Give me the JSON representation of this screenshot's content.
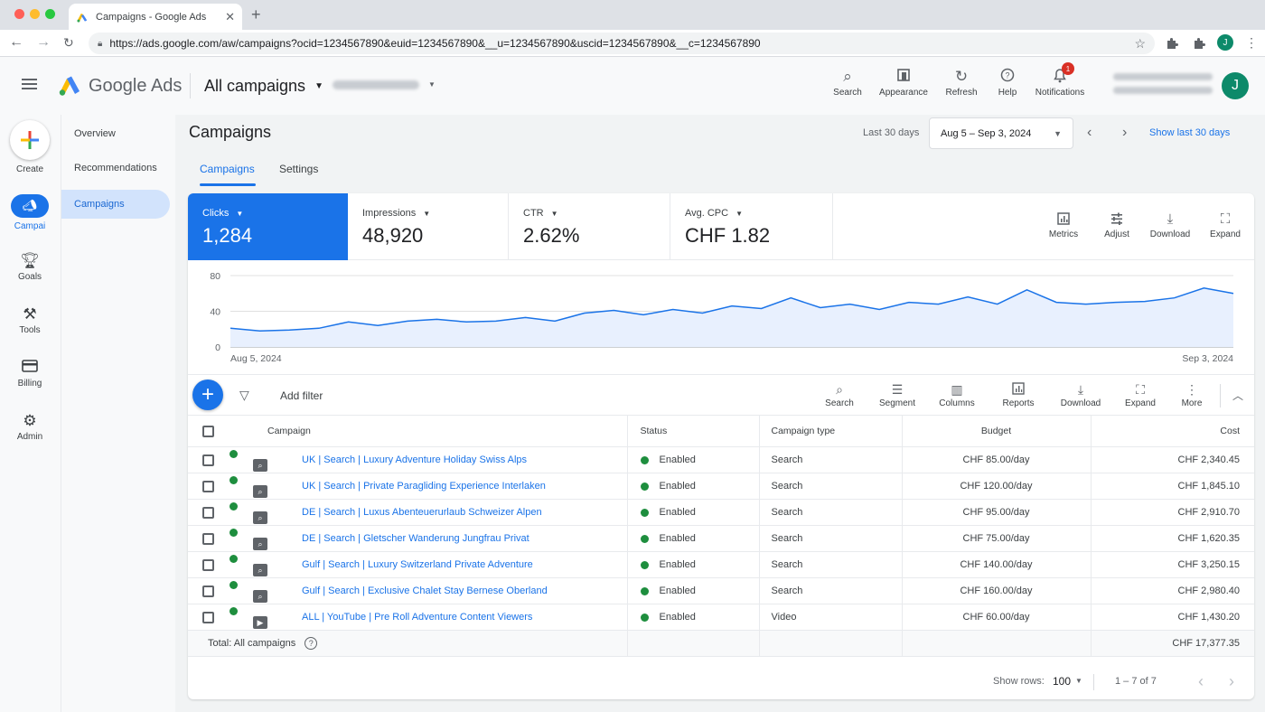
{
  "browser": {
    "tab_title": "Campaigns - Google Ads",
    "tab_close": "✕",
    "new_tab": "+",
    "url": "https://ads.google.com/aw/campaigns?ocid=1234567890&euid=1234567890&__u=1234567890&uscid=1234567890&__c=1234567890",
    "profile_initial": "J"
  },
  "header": {
    "product_name": "Google Ads",
    "view_title": "All campaigns",
    "actions": [
      {
        "label": "Search",
        "icon": "search-icon"
      },
      {
        "label": "Appearance",
        "icon": "appearance-icon"
      },
      {
        "label": "Refresh",
        "icon": "refresh-icon"
      },
      {
        "label": "Help",
        "icon": "help-icon"
      },
      {
        "label": "Notifications",
        "icon": "bell-icon"
      }
    ],
    "notification_count": "1",
    "avatar_initial": "J"
  },
  "rail": {
    "create_label": "Create",
    "items": [
      {
        "label": "Campai",
        "icon": "campaigns-icon"
      },
      {
        "label": "Goals",
        "icon": "goals-icon"
      },
      {
        "label": "Tools",
        "icon": "tools-icon"
      },
      {
        "label": "Billing",
        "icon": "billing-icon"
      },
      {
        "label": "Admin",
        "icon": "admin-icon"
      }
    ]
  },
  "subnav": {
    "items": [
      {
        "label": "Overview"
      },
      {
        "label": "Recommendations"
      },
      {
        "label": "Campaigns"
      }
    ]
  },
  "page": {
    "title": "Campaigns",
    "date_label": "Last 30 days",
    "date_range": "Aug 5 – Sep 3, 2024",
    "show_last": "Show last 30 days",
    "tabs": [
      {
        "label": "Campaigns"
      },
      {
        "label": "Settings"
      }
    ]
  },
  "metrics": [
    {
      "label": "Clicks",
      "value": "1,284"
    },
    {
      "label": "Impressions",
      "value": "48,920"
    },
    {
      "label": "CTR",
      "value": "2.62%"
    },
    {
      "label": "Avg. CPC",
      "value": "CHF 1.82"
    }
  ],
  "card_actions": [
    {
      "label": "Metrics",
      "icon": "metrics-icon"
    },
    {
      "label": "Adjust",
      "icon": "adjust-icon"
    },
    {
      "label": "Download",
      "icon": "download-icon"
    },
    {
      "label": "Expand",
      "icon": "expand-icon"
    }
  ],
  "chart_data": {
    "type": "area",
    "x_start_label": "Aug 5, 2024",
    "x_end_label": "Sep 3, 2024",
    "ylim": [
      0,
      80
    ],
    "yticks": [
      "80",
      "40",
      "0"
    ],
    "values": [
      21,
      18,
      19,
      21,
      28,
      24,
      29,
      31,
      28,
      29,
      33,
      29,
      38,
      41,
      36,
      42,
      38,
      46,
      43,
      55,
      44,
      48,
      42,
      50,
      48,
      56,
      48,
      64,
      50,
      48,
      50,
      51,
      55,
      66,
      60
    ],
    "series_color": "#1a73e8",
    "grid": true
  },
  "table_toolbar": {
    "add_filter": "Add filter",
    "actions": [
      {
        "label": "Search",
        "icon": "search-icon"
      },
      {
        "label": "Segment",
        "icon": "segment-icon"
      },
      {
        "label": "Columns",
        "icon": "columns-icon"
      },
      {
        "label": "Reports",
        "icon": "reports-icon"
      },
      {
        "label": "Download",
        "icon": "download-icon"
      },
      {
        "label": "Expand",
        "icon": "expand-icon"
      },
      {
        "label": "More",
        "icon": "more-icon"
      }
    ]
  },
  "table": {
    "columns": [
      "Campaign",
      "Status",
      "Campaign type",
      "Budget",
      "Cost"
    ],
    "rows": [
      {
        "campaign": "UK | Search | Luxury Adventure Holiday Swiss Alps",
        "status": "Enabled",
        "type": "Search",
        "budget": "CHF 85.00/day",
        "cost": "CHF 2,340.45"
      },
      {
        "campaign": "UK | Search | Private Paragliding Experience Interlaken",
        "status": "Enabled",
        "type": "Search",
        "budget": "CHF 120.00/day",
        "cost": "CHF 1,845.10"
      },
      {
        "campaign": "DE | Search | Luxus Abenteuerurlaub Schweizer Alpen",
        "status": "Enabled",
        "type": "Search",
        "budget": "CHF 95.00/day",
        "cost": "CHF 2,910.70"
      },
      {
        "campaign": "DE | Search | Gletscher Wanderung Jungfrau Privat",
        "status": "Enabled",
        "type": "Search",
        "budget": "CHF 75.00/day",
        "cost": "CHF 1,620.35"
      },
      {
        "campaign": "Gulf | Search | Luxury Switzerland Private Adventure",
        "status": "Enabled",
        "type": "Search",
        "budget": "CHF 140.00/day",
        "cost": "CHF 3,250.15"
      },
      {
        "campaign": "Gulf | Search | Exclusive Chalet Stay Bernese Oberland",
        "status": "Enabled",
        "type": "Search",
        "budget": "CHF 160.00/day",
        "cost": "CHF 2,980.40"
      },
      {
        "campaign": "ALL | YouTube | Pre Roll Adventure Content Viewers",
        "status": "Enabled",
        "type": "Video",
        "budget": "CHF 60.00/day",
        "cost": "CHF 1,430.20"
      }
    ],
    "total_label": "Total: All campaigns",
    "total_cost": "CHF 17,377.35"
  },
  "pager": {
    "show_rows_label": "Show rows:",
    "rows_value": "100",
    "range": "1 – 7 of 7"
  },
  "colors": {
    "accent": "#1a73e8",
    "enabled": "#1e8e3e",
    "badge": "#d93025"
  }
}
